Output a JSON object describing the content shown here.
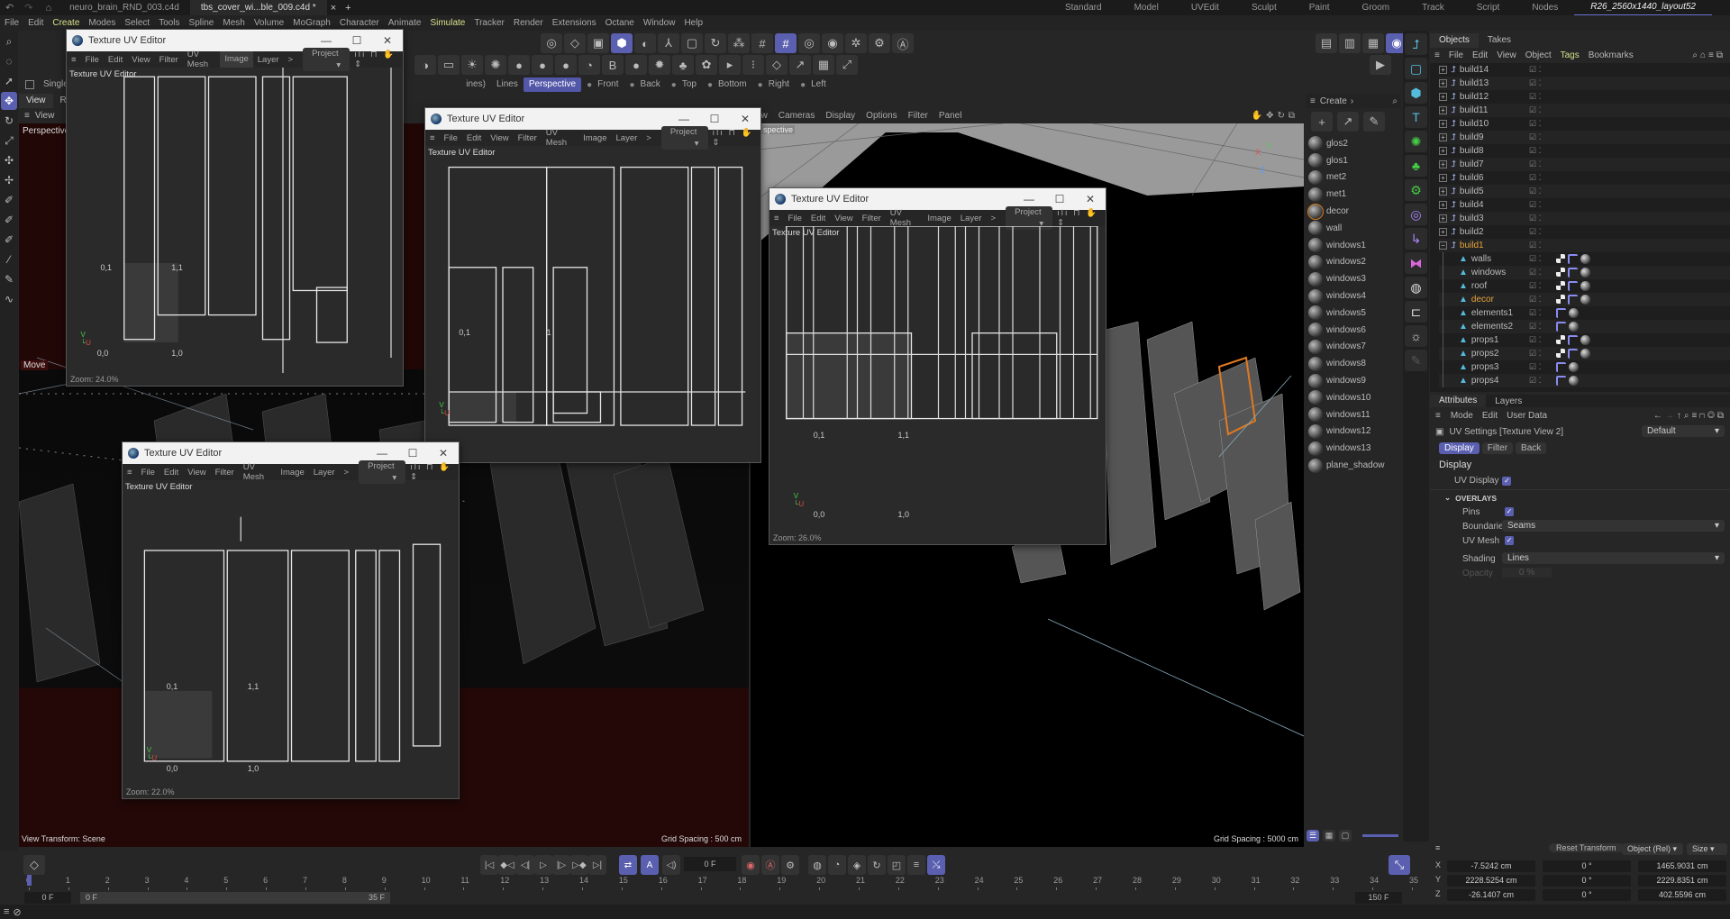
{
  "top_tabs": [
    "neuro_brain_RND_003.c4d",
    "tbs_cover_wi...ble_009.c4d *"
  ],
  "top_tabs_active": 1,
  "layouts": [
    "Standard",
    "Model",
    "UVEdit",
    "Sculpt",
    "Paint",
    "Groom",
    "Track",
    "Script",
    "Nodes",
    "R26_2560x1440_layout52"
  ],
  "menu": [
    "File",
    "Edit",
    "Create",
    "Modes",
    "Select",
    "Tools",
    "Spline",
    "Mesh",
    "Volume",
    "MoGraph",
    "Character",
    "Animate",
    "Simulate",
    "Tracker",
    "Render",
    "Extensions",
    "Octane",
    "Window",
    "Help"
  ],
  "menu_highlight": [
    "Create",
    "Simulate"
  ],
  "view_bar": {
    "single_view": "Single V",
    "lines_partial": "ines)",
    "lines": "Lines",
    "cameras": [
      "Perspective",
      "Front",
      "Back",
      "Top",
      "Bottom",
      "Right",
      "Left"
    ]
  },
  "left_viewport": {
    "tabs": [
      "View",
      "Re"
    ],
    "menu": "View",
    "camera": "Perspective",
    "tool": "Move",
    "view_transform": "View Transform: Scene",
    "grid_spacing": "Grid Spacing : 500 cm"
  },
  "right_viewport": {
    "menu": [
      "ew",
      "Cameras",
      "Display",
      "Options",
      "Filter",
      "Panel"
    ],
    "camera": "spective",
    "grid_spacing": "Grid Spacing : 5000 cm"
  },
  "uv_editors": [
    {
      "title": "Texture UV Editor",
      "menu": [
        "File",
        "Edit",
        "View",
        "Filter",
        "UV Mesh",
        "Image",
        "Layer",
        ">"
      ],
      "active_menu": "Image",
      "project": "Project",
      "label": "Texture UV Editor",
      "axes": [
        "0,1",
        "1,1",
        "0,0",
        "1,0"
      ],
      "zoom": "Zoom: 24.0%"
    },
    {
      "title": "Texture UV Editor",
      "menu": [
        "File",
        "Edit",
        "View",
        "Filter",
        "UV Mesh",
        "Image",
        "Layer",
        ">"
      ],
      "project": "Project",
      "label": "Texture UV Editor",
      "axes": [
        "0,1",
        "1"
      ]
    },
    {
      "title": "Texture UV Editor",
      "menu": [
        "File",
        "Edit",
        "View",
        "Filter",
        "UV Mesh",
        "Image",
        "Layer",
        ">"
      ],
      "project": "Project",
      "label": "Texture UV Editor",
      "axes": [
        "0,1",
        "1,1",
        "0,0",
        "1,0"
      ],
      "zoom": "Zoom: 26.0%"
    },
    {
      "title": "Texture UV Editor",
      "menu": [
        "File",
        "Edit",
        "View",
        "Filter",
        "UV Mesh",
        "Image",
        "Layer",
        ">"
      ],
      "project": "Project",
      "label": "Texture UV Editor",
      "axes": [
        "0,1",
        "1,1",
        "0,0",
        "1,0"
      ],
      "zoom": "Zoom: 22.0%"
    }
  ],
  "materials": {
    "header": "Create",
    "items": [
      "glos2",
      "glos1",
      "met2",
      "met1",
      "decor",
      "wall",
      "windows1",
      "windows2",
      "windows3",
      "windows4",
      "windows5",
      "windows6",
      "windows7",
      "windows8",
      "windows9",
      "windows10",
      "windows11",
      "windows12",
      "windows13",
      "plane_shadow"
    ],
    "selected": "decor"
  },
  "objects": {
    "tabs": [
      "Objects",
      "Takes"
    ],
    "menu": [
      "File",
      "Edit",
      "View",
      "Object",
      "Tags",
      "Bookmarks"
    ],
    "rows": [
      {
        "name": "build14",
        "type": "null"
      },
      {
        "name": "build13",
        "type": "null"
      },
      {
        "name": "build12",
        "type": "null"
      },
      {
        "name": "build11",
        "type": "null"
      },
      {
        "name": "build10",
        "type": "null"
      },
      {
        "name": "build9",
        "type": "null"
      },
      {
        "name": "build8",
        "type": "null"
      },
      {
        "name": "build7",
        "type": "null"
      },
      {
        "name": "build6",
        "type": "null"
      },
      {
        "name": "build5",
        "type": "null"
      },
      {
        "name": "build4",
        "type": "null"
      },
      {
        "name": "build3",
        "type": "null"
      },
      {
        "name": "build2",
        "type": "null"
      },
      {
        "name": "build1",
        "type": "null",
        "selected": true,
        "expanded": true
      },
      {
        "name": "walls",
        "type": "poly",
        "tags": [
          "chk",
          "uvw",
          "mt"
        ]
      },
      {
        "name": "windows",
        "type": "poly",
        "tags": [
          "chk",
          "uvw",
          "mt"
        ]
      },
      {
        "name": "roof",
        "type": "poly",
        "tags": [
          "chk",
          "uvw",
          "mt"
        ]
      },
      {
        "name": "decor",
        "type": "poly",
        "selected": true,
        "tags": [
          "chk",
          "uvw",
          "mt"
        ]
      },
      {
        "name": "elements1",
        "type": "poly",
        "tags": [
          "uvw",
          "mt"
        ]
      },
      {
        "name": "elements2",
        "type": "poly",
        "tags": [
          "uvw",
          "mt"
        ]
      },
      {
        "name": "props1",
        "type": "poly",
        "tags": [
          "chk",
          "uvw",
          "mt"
        ]
      },
      {
        "name": "props2",
        "type": "poly",
        "tags": [
          "chk",
          "uvw",
          "mt"
        ]
      },
      {
        "name": "props3",
        "type": "poly",
        "tags": [
          "uvw",
          "mt"
        ]
      },
      {
        "name": "props4",
        "type": "poly",
        "tags": [
          "uvw",
          "mt"
        ]
      }
    ]
  },
  "attributes": {
    "tabs": [
      "Attributes",
      "Layers"
    ],
    "menu": [
      "Mode",
      "Edit",
      "User Data"
    ],
    "title": "UV Settings [Texture View 2]",
    "preset": "Default",
    "subtabs": [
      "Display",
      "Filter",
      "Back"
    ],
    "section": "Display",
    "uv_display": {
      "label": "UV Display",
      "checked": true
    },
    "overlays": "OVERLAYS",
    "pins": {
      "label": "Pins",
      "checked": true
    },
    "boundaries": {
      "label": "Boundaries",
      "value": "Seams"
    },
    "uv_mesh": {
      "label": "UV Mesh",
      "checked": true
    },
    "shading": {
      "label": "Shading",
      "value": "Lines"
    },
    "opacity": {
      "label": "Opacity",
      "value": "0 %"
    }
  },
  "coordinates": {
    "reset": "Reset Transform",
    "mode": "Object (Rel)",
    "size_mode": "Size",
    "rows": [
      {
        "axis": "X",
        "pos": "-7.5242 cm",
        "rot": "0 °",
        "size": "1465.9031 cm"
      },
      {
        "axis": "Y",
        "pos": "2228.5254 cm",
        "rot": "0 °",
        "size": "2229.8351 cm"
      },
      {
        "axis": "Z",
        "pos": "-26.1407 cm",
        "rot": "0 °",
        "size": "402.5596 cm"
      }
    ]
  },
  "timeline": {
    "current_frame": "0 F",
    "start": "0 F",
    "range_start": "0 F",
    "range_end": "35 F",
    "end": "150 F",
    "ticks": [
      "0",
      "1",
      "2",
      "3",
      "4",
      "5",
      "6",
      "7",
      "8",
      "9",
      "10",
      "11",
      "12",
      "13",
      "14",
      "15",
      "16",
      "17",
      "18",
      "19",
      "20",
      "21",
      "22",
      "23",
      "24",
      "25",
      "26",
      "27",
      "28",
      "29",
      "30",
      "31",
      "32",
      "33",
      "34",
      "35"
    ]
  },
  "colors": {
    "accent": "#5a5fb0",
    "selected": "#e8a53a",
    "highlight_menu": "#d7e08a"
  }
}
